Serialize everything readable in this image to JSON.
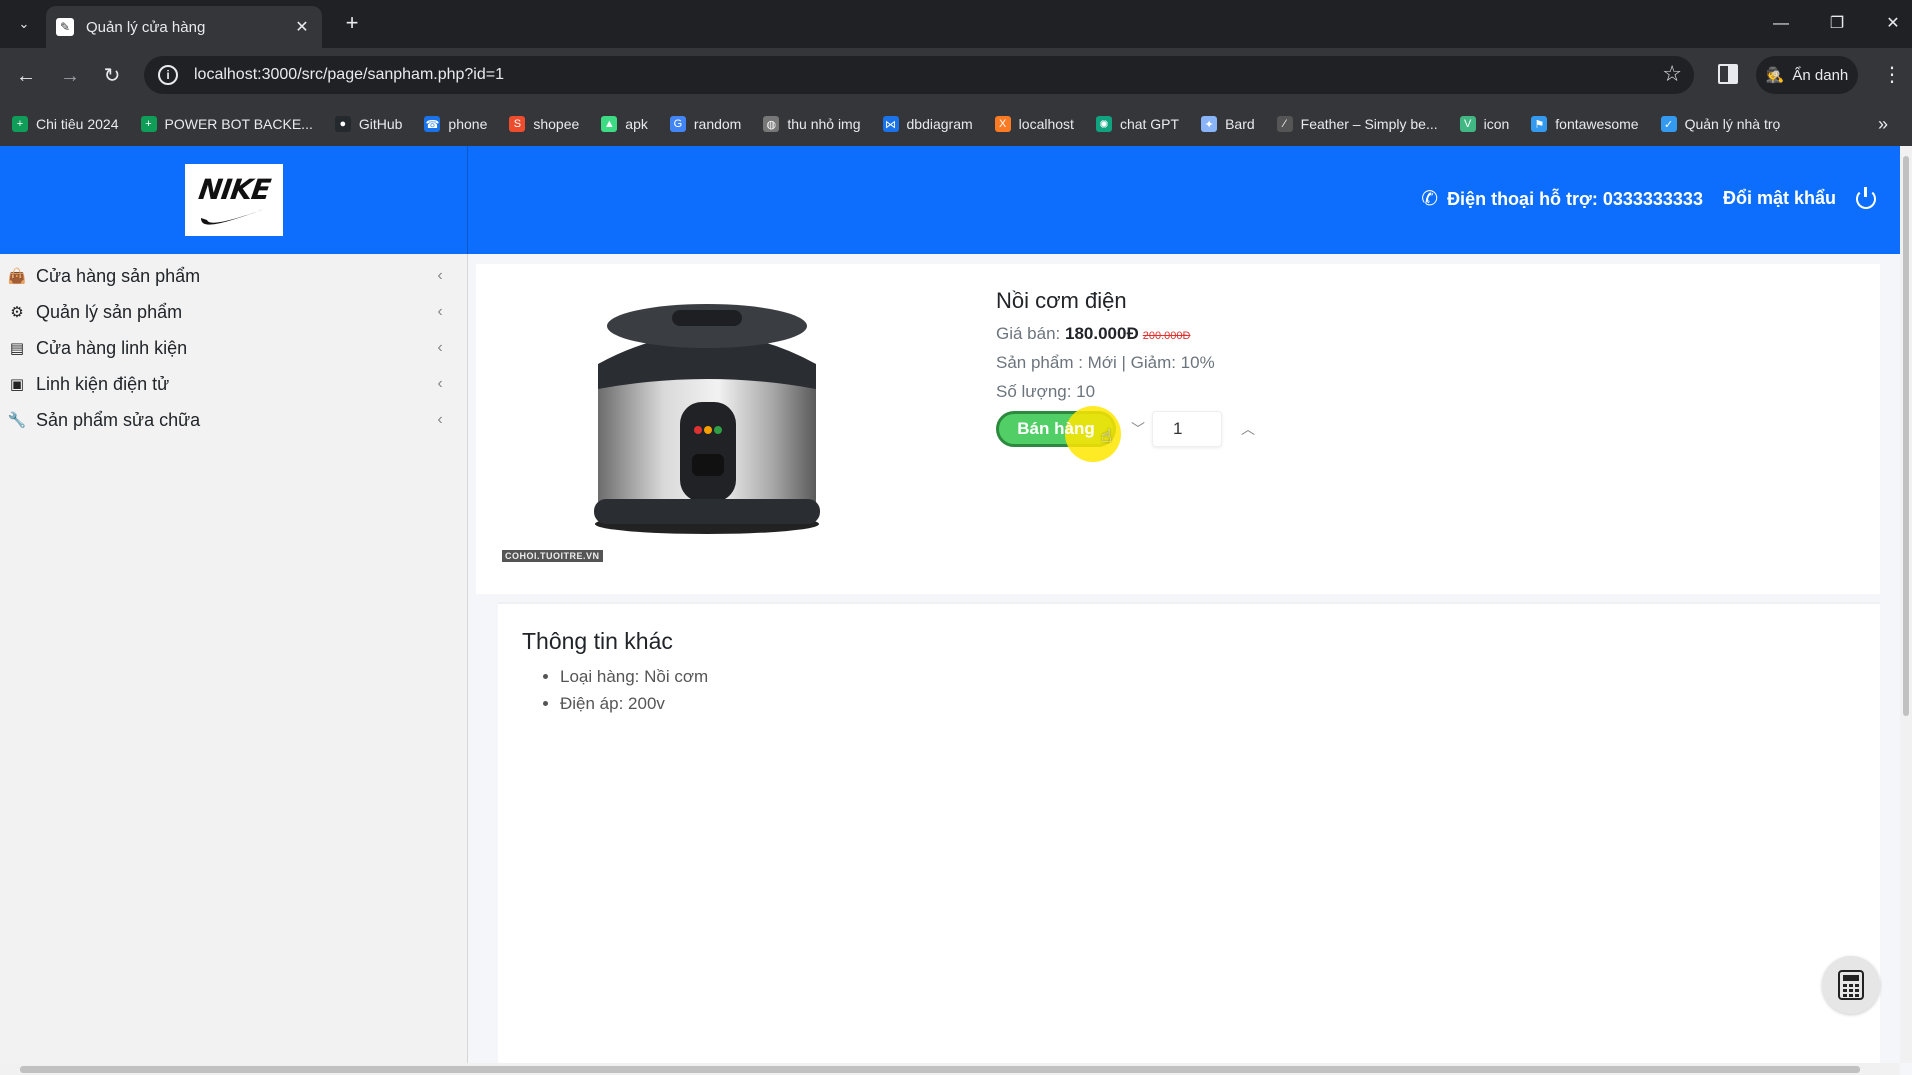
{
  "browser": {
    "tab_title": "Quản lý cửa hàng",
    "url": "localhost:3000/src/page/sanpham.php?id=1",
    "profile_label": "Ẩn danh"
  },
  "bookmarks": [
    {
      "label": "Chi tiêu 2024",
      "icon": "sheets-icon",
      "color": "#0f9d58"
    },
    {
      "label": "POWER BOT BACKE...",
      "icon": "sheets-icon",
      "color": "#0f9d58"
    },
    {
      "label": "GitHub",
      "icon": "github-icon",
      "color": "#24292e"
    },
    {
      "label": "phone",
      "icon": "phone-icon",
      "color": "#1a73e8"
    },
    {
      "label": "shopee",
      "icon": "shopee-icon",
      "color": "#ee4d2d"
    },
    {
      "label": "apk",
      "icon": "android-icon",
      "color": "#3ddc84"
    },
    {
      "label": "random",
      "icon": "google-icon",
      "color": "#4285f4"
    },
    {
      "label": "thu nhỏ img",
      "icon": "globe-icon",
      "color": "#777777"
    },
    {
      "label": "dbdiagram",
      "icon": "share-icon",
      "color": "#1a73e8"
    },
    {
      "label": "localhost",
      "icon": "xampp-icon",
      "color": "#fb7a24"
    },
    {
      "label": "chat GPT",
      "icon": "openai-icon",
      "color": "#10a37f"
    },
    {
      "label": "Bard",
      "icon": "sparkle-icon",
      "color": "#8ab4f8"
    },
    {
      "label": "Feather – Simply be...",
      "icon": "feather-icon",
      "color": "#555555"
    },
    {
      "label": "icon",
      "icon": "vue-icon",
      "color": "#41b883"
    },
    {
      "label": "fontawesome",
      "icon": "flag-icon",
      "color": "#339af0"
    },
    {
      "label": "Quản lý nhà trọ",
      "icon": "check-icon",
      "color": "#339af0"
    }
  ],
  "header": {
    "logo_text": "NIKE",
    "support_text": "Điện thoại hỗ trợ: 0333333333",
    "change_password": "Đổi mật khẩu",
    "brand_color": "#0d6efd"
  },
  "sidebar": {
    "items": [
      {
        "label": "Cửa hàng sản phẩm",
        "icon": "shopping-bag-icon"
      },
      {
        "label": "Quản lý sản phẩm",
        "icon": "boxes-icon"
      },
      {
        "label": "Cửa hàng linh kiện",
        "icon": "server-icon"
      },
      {
        "label": "Linh kiện điện tử",
        "icon": "microchip-icon"
      },
      {
        "label": "Sản phẩm sửa chữa",
        "icon": "wrench-icon"
      }
    ]
  },
  "product": {
    "name": "Nồi cơm điện",
    "price_label": "Giá bán: ",
    "price": "180.000Đ",
    "old_price": "200.000Đ",
    "status_line": "Sản phẩm : Mới | Giảm: 10%",
    "quantity_line": "Số lượng: 10",
    "sell_button": "Bán hàng",
    "quantity_value": "1",
    "image_credit": "COHOI.TUOITRE.VN"
  },
  "other_info": {
    "title": "Thông tin khác",
    "attributes": [
      "Loại hàng: Nồi cơm",
      "Điện áp: 200v"
    ]
  }
}
